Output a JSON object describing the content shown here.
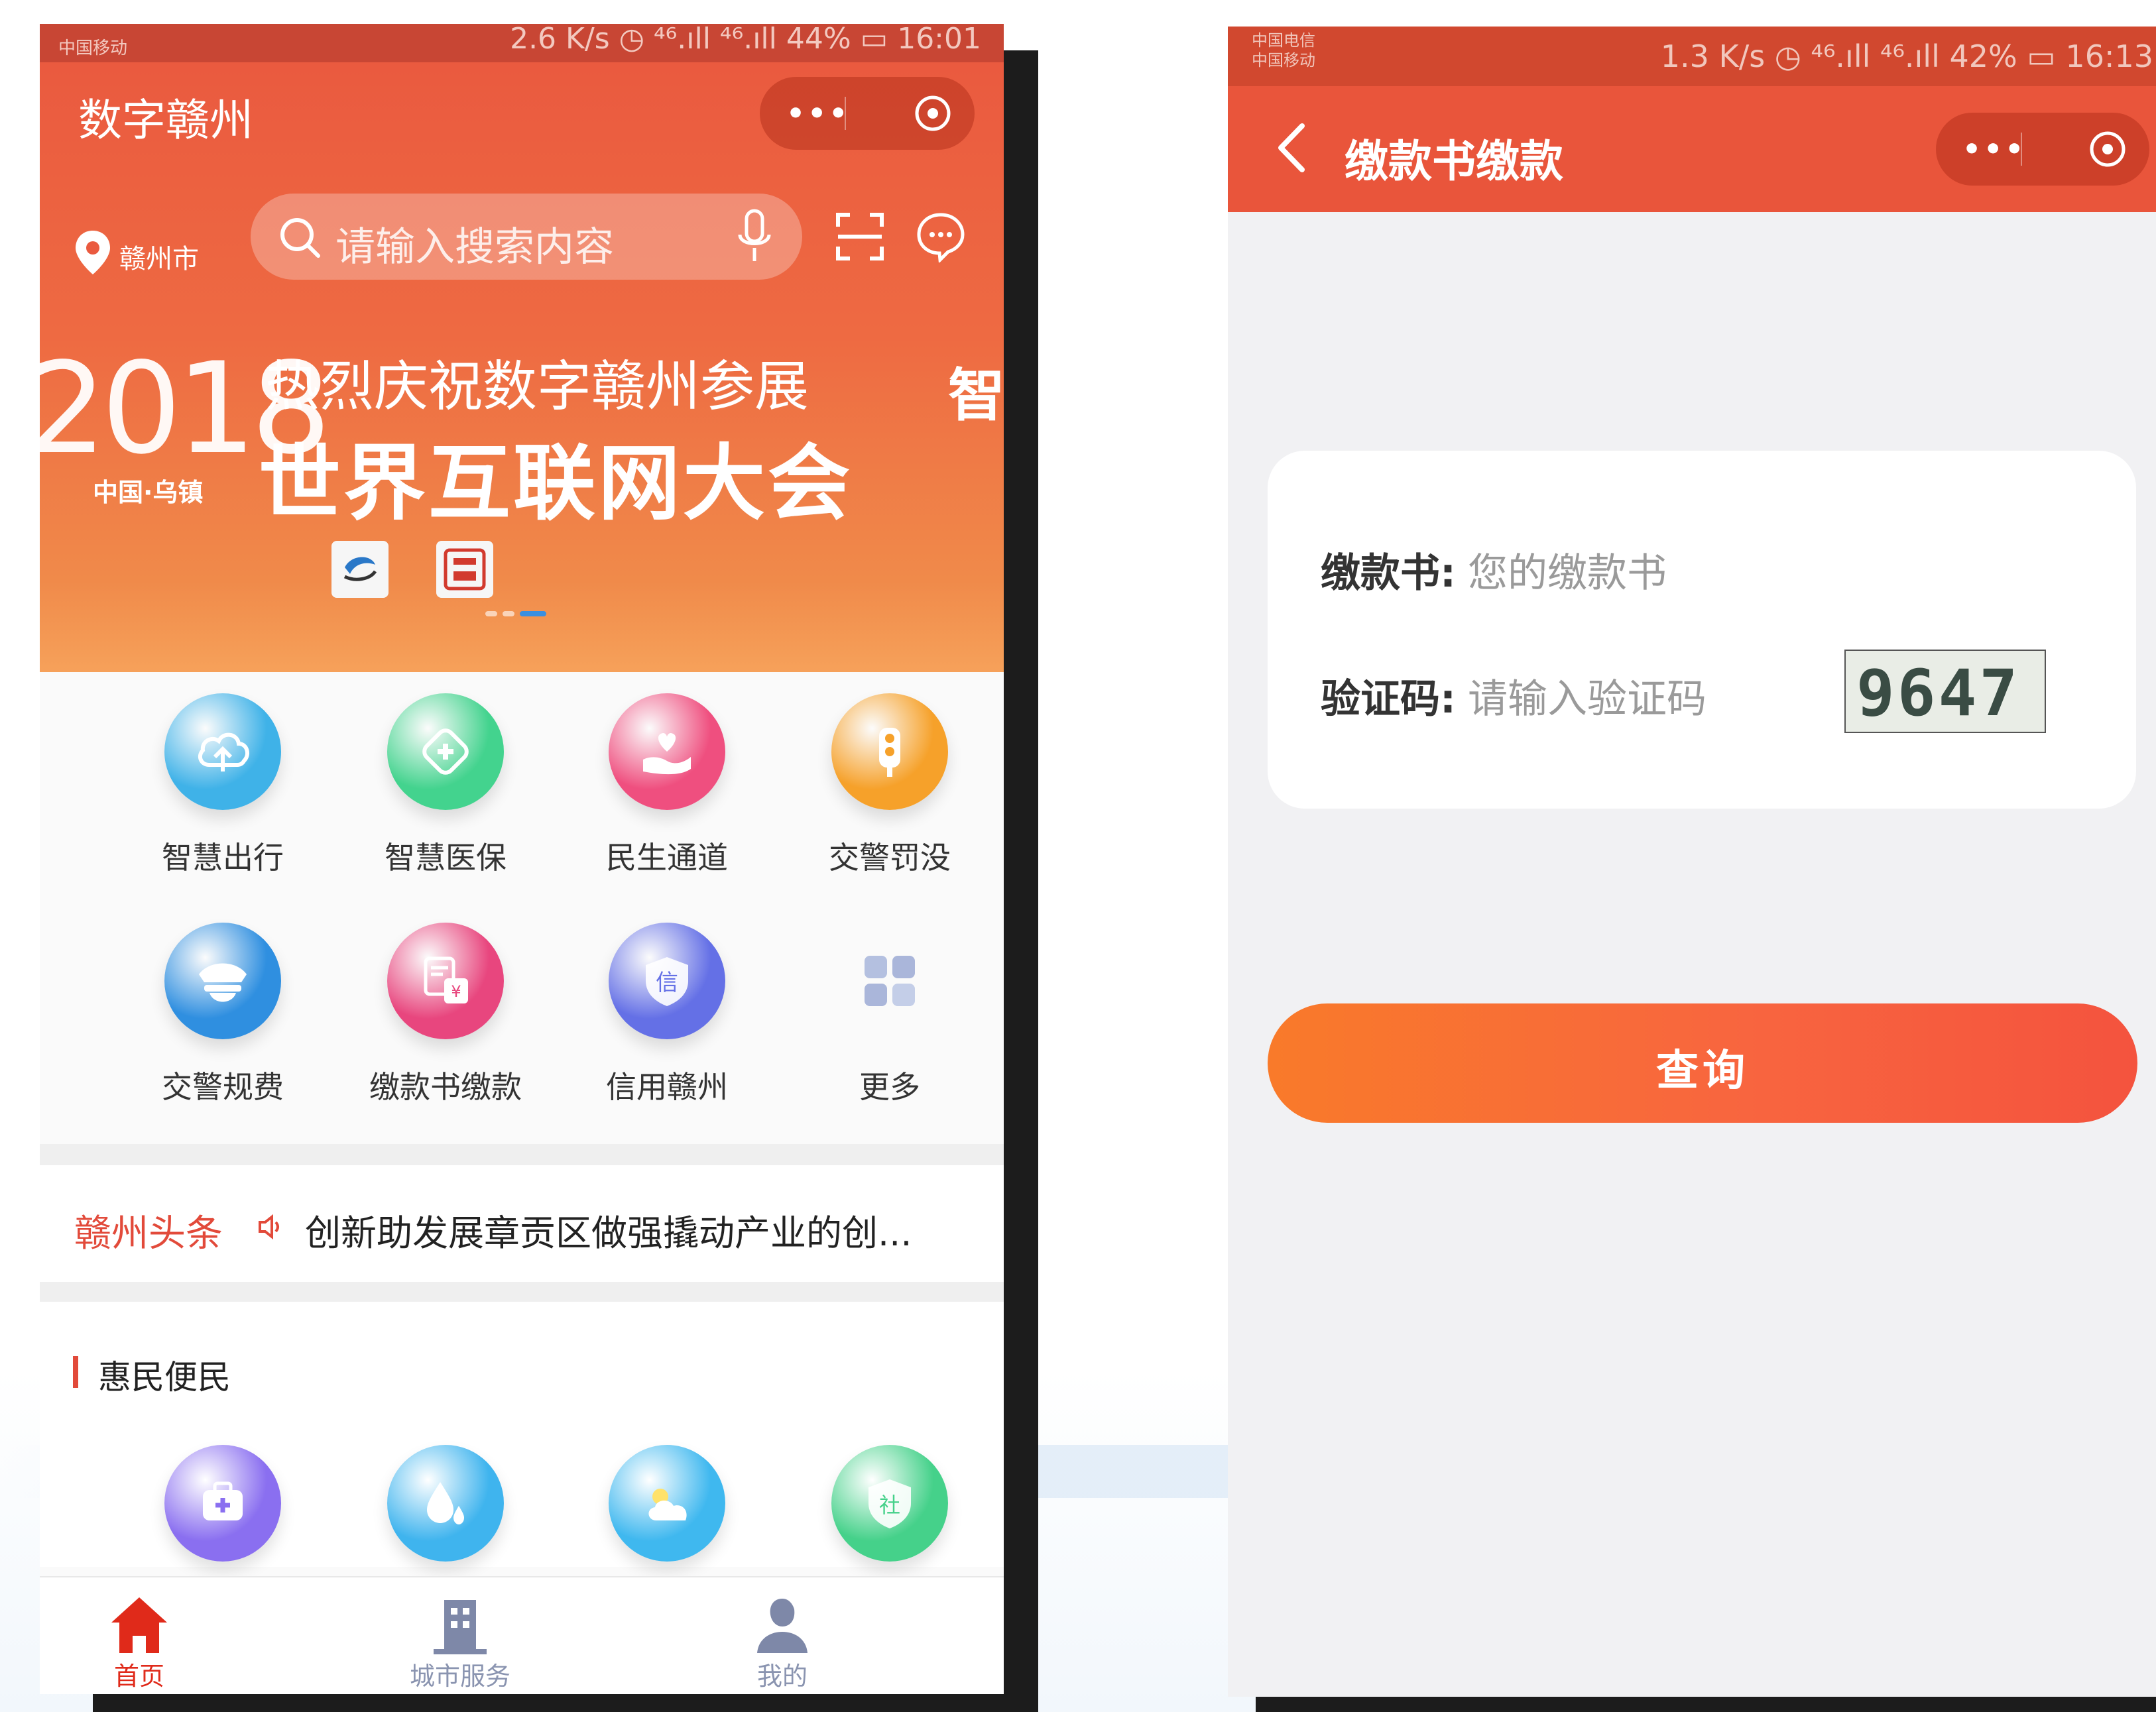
{
  "left_phone": {
    "status_bar": {
      "carrier": "中国移动",
      "right": "2.6 K/s ◷ ⁴⁶.ıll ⁴⁶.ıll 44% ▭ 16:01"
    },
    "app_title": "数字赣州",
    "capsule": {
      "more": "•••"
    },
    "location": "赣州市",
    "search": {
      "placeholder": "请输入搜索内容"
    },
    "banner": {
      "year": "2018",
      "sub": "中国·乌镇",
      "line1": "热烈庆祝数字赣州参展",
      "line2": "世界互联网大会",
      "side_text": "智"
    },
    "services": [
      {
        "label": "智慧出行",
        "icon": "cloud-upload-icon",
        "color": "#3fb2e8"
      },
      {
        "label": "智慧医保",
        "icon": "medical-cross-icon",
        "color": "#43d38e"
      },
      {
        "label": "民生通道",
        "icon": "heart-hand-icon",
        "color": "#ef4f7f"
      },
      {
        "label": "交警罚没",
        "icon": "traffic-light-icon",
        "color": "#f6a12a"
      },
      {
        "label": "交警规费",
        "icon": "police-cap-icon",
        "color": "#2f8fe0"
      },
      {
        "label": "缴款书缴款",
        "icon": "payment-doc-icon",
        "color": "#e8467e"
      },
      {
        "label": "信用赣州",
        "icon": "credit-shield-icon",
        "color": "#6470e6"
      },
      {
        "label": "更多",
        "icon": "more-grid-icon",
        "color": "#b8c6e4"
      }
    ],
    "news": {
      "tag": "赣州头条",
      "text": "创新助发展章贡区做强撬动产业的创..."
    },
    "section_title": "惠民便民",
    "section_icons": [
      {
        "icon": "medical-kit-icon",
        "color": "#8a6ff0"
      },
      {
        "icon": "water-drop-icon",
        "color": "#3fb4ee"
      },
      {
        "icon": "weather-icon",
        "color": "#3fb8ef"
      },
      {
        "icon": "social-shield-icon",
        "color": "#45d18a"
      }
    ],
    "tabs": [
      {
        "label": "首页",
        "active": true
      },
      {
        "label": "城市服务",
        "active": false
      },
      {
        "label": "我的",
        "active": false
      }
    ]
  },
  "right_phone": {
    "status_bar": {
      "carrier1": "中国电信",
      "carrier2": "中国移动",
      "right": "1.3 K/s ◷ ⁴⁶.ıll ⁴⁶.ıll 42% ▭ 16:13"
    },
    "nav_title": "缴款书缴款",
    "capsule": {
      "more": "•••"
    },
    "form": {
      "doc_label": "缴款书:",
      "doc_placeholder": "您的缴款书",
      "code_label": "验证码:",
      "code_placeholder": "请输入验证码",
      "captcha": "9647"
    },
    "query_button": "查询"
  },
  "colors": {
    "brand_red": "#e9553b",
    "accent_orange": "#f97a2a",
    "active_tab": "#e02a1a",
    "inactive_tab": "#8a94b0"
  }
}
